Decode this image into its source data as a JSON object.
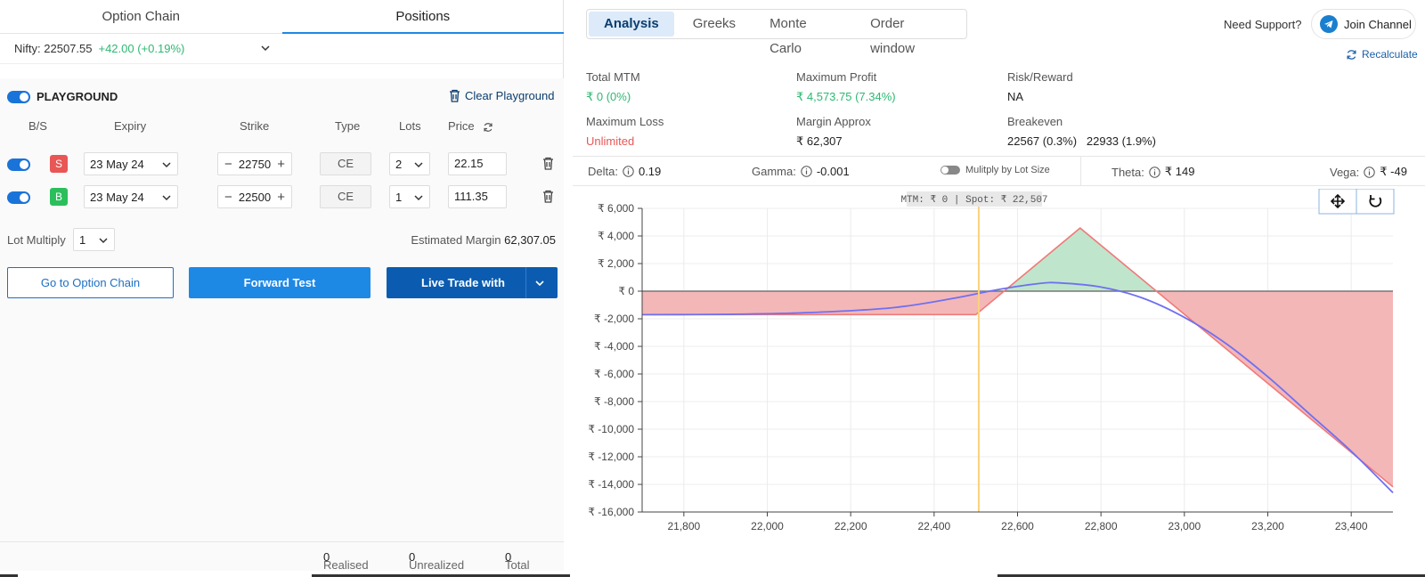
{
  "left_tabs": {
    "option_chain": "Option Chain",
    "positions": "Positions"
  },
  "nifty": {
    "label": "Nifty:",
    "price": "22507.55",
    "change": "+42.00 (+0.19%)"
  },
  "playground": {
    "title": "PLAYGROUND",
    "clear": "Clear Playground"
  },
  "columns": {
    "bs": "B/S",
    "expiry": "Expiry",
    "strike": "Strike",
    "type": "Type",
    "lots": "Lots",
    "price": "Price"
  },
  "legs": [
    {
      "side": "S",
      "expiry": "23 May 24",
      "strike": "22750",
      "type": "CE",
      "lots": "2",
      "price": "22.15"
    },
    {
      "side": "B",
      "expiry": "23 May 24",
      "strike": "22500",
      "type": "CE",
      "lots": "1",
      "price": "111.35"
    }
  ],
  "lot_multiply": {
    "label": "Lot Multiply",
    "value": "1"
  },
  "estimated_margin": {
    "label": "Estimated Margin",
    "value": "62,307.05"
  },
  "buttons": {
    "go_chain": "Go to Option Chain",
    "forward_test": "Forward Test",
    "live_trade": "Live Trade with"
  },
  "footer": {
    "realised_label": "Realised",
    "realised": "0",
    "unrealized_label": "Unrealized",
    "unrealized": "0",
    "total_label": "Total",
    "total": "0"
  },
  "right_tabs": [
    "Analysis",
    "Greeks",
    "Monte Carlo",
    "Order window"
  ],
  "support": {
    "need": "Need Support?",
    "join": "Join Channel",
    "recalculate": "Recalculate"
  },
  "stats": {
    "total_mtm": {
      "label": "Total MTM",
      "value": "₹ 0 (0%)"
    },
    "max_profit": {
      "label": "Maximum Profit",
      "value": "₹ 4,573.75 (7.34%)"
    },
    "risk_reward": {
      "label": "Risk/Reward",
      "value": "NA"
    },
    "max_loss": {
      "label": "Maximum Loss",
      "value": "Unlimited"
    },
    "margin": {
      "label": "Margin Approx",
      "value": "₹ 62,307"
    },
    "breakeven": {
      "label": "Breakeven",
      "value": "22567 (0.3%)   22933 (1.9%)"
    }
  },
  "greeks": {
    "delta": {
      "label": "Delta:",
      "value": "0.19"
    },
    "gamma": {
      "label": "Gamma:",
      "value": "-0.001"
    },
    "multiply": "Mulitply by Lot Size",
    "theta": {
      "label": "Theta:",
      "value": "₹ 149"
    },
    "vega": {
      "label": "Vega:",
      "value": "₹ -49"
    }
  },
  "colors": {
    "accent": "#1e88e5",
    "profit": "#2eb872",
    "loss": "#e85656",
    "payoff_fill_pos": "#bfe6cc",
    "payoff_fill_neg": "#f4b7b7",
    "expiry_line": "#f07a7a",
    "today_line": "#6f70f0",
    "spot_line": "#f9d27c"
  },
  "chart_data": {
    "type": "area",
    "tooltip": "MTM: ₹ 0  |  Spot: ₹ 22,507",
    "xlim": [
      21700,
      23500
    ],
    "ylim": [
      -16000,
      6000
    ],
    "x_ticks": [
      21800,
      22000,
      22200,
      22400,
      22600,
      22800,
      23000,
      23200,
      23400
    ],
    "x_tick_labels": [
      "21,800",
      "22,000",
      "22,200",
      "22,400",
      "22,600",
      "22,800",
      "23,000",
      "23,200",
      "23,400"
    ],
    "y_ticks": [
      6000,
      4000,
      2000,
      0,
      -2000,
      -4000,
      -6000,
      -8000,
      -10000,
      -12000,
      -14000,
      -16000
    ],
    "y_tick_labels": [
      "₹ 6,000",
      "₹ 4,000",
      "₹ 2,000",
      "₹ 0",
      "₹ -2,000",
      "₹ -4,000",
      "₹ -6,000",
      "₹ -8,000",
      "₹ -10,000",
      "₹ -12,000",
      "₹ -14,000",
      "₹ -16,000"
    ],
    "spot": 22507,
    "series": [
      {
        "values": [
          [
            21700,
            -1700
          ],
          [
            22500,
            -1700
          ],
          [
            22750,
            4575
          ],
          [
            23500,
            -14175
          ]
        ]
      },
      {
        "values": [
          [
            21700,
            -1700
          ],
          [
            21900,
            -1680
          ],
          [
            22100,
            -1550
          ],
          [
            22300,
            -1200
          ],
          [
            22450,
            -500
          ],
          [
            22550,
            100
          ],
          [
            22650,
            550
          ],
          [
            22700,
            600
          ],
          [
            22800,
            300
          ],
          [
            22900,
            -500
          ],
          [
            23000,
            -1900
          ],
          [
            23100,
            -3800
          ],
          [
            23200,
            -6200
          ],
          [
            23300,
            -8900
          ],
          [
            23400,
            -11600
          ],
          [
            23500,
            -14600
          ]
        ]
      }
    ]
  }
}
